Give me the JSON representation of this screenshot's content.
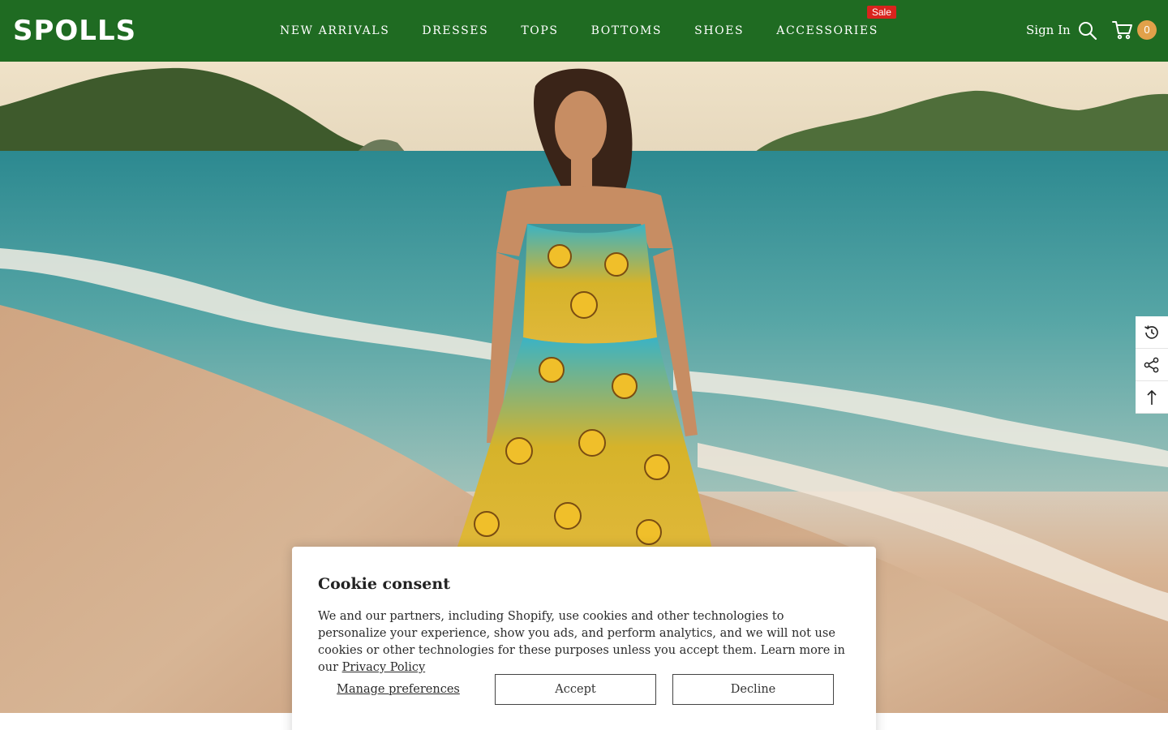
{
  "brand": {
    "logo_text": "SPOLLS",
    "header_color": "#1f6b22"
  },
  "nav": {
    "items": [
      {
        "label": "NEW ARRIVALS"
      },
      {
        "label": "DRESSES"
      },
      {
        "label": "TOPS"
      },
      {
        "label": "BOTTOMS"
      },
      {
        "label": "SHOES"
      },
      {
        "label": "ACCESSORIES",
        "badge": "Sale"
      }
    ]
  },
  "header_actions": {
    "signin_label": "Sign In",
    "search_icon": "search-icon",
    "cart_icon": "cart-icon",
    "cart_count": "0"
  },
  "hero": {
    "image_alt": "Woman in sunflower print maxi dress walking on a beach"
  },
  "side_tools": [
    {
      "icon": "recently-viewed-icon"
    },
    {
      "icon": "share-icon"
    },
    {
      "icon": "back-to-top-icon"
    }
  ],
  "cookie": {
    "title": "Cookie consent",
    "body": "We and our partners, including Shopify, use cookies and other technologies to personalize your experience, show you ads, and perform analytics, and we will not use cookies or other technologies for these purposes unless you accept them. Learn more in our ",
    "privacy_link": "Privacy Policy",
    "manage_label": "Manage preferences",
    "accept_label": "Accept",
    "decline_label": "Decline"
  }
}
